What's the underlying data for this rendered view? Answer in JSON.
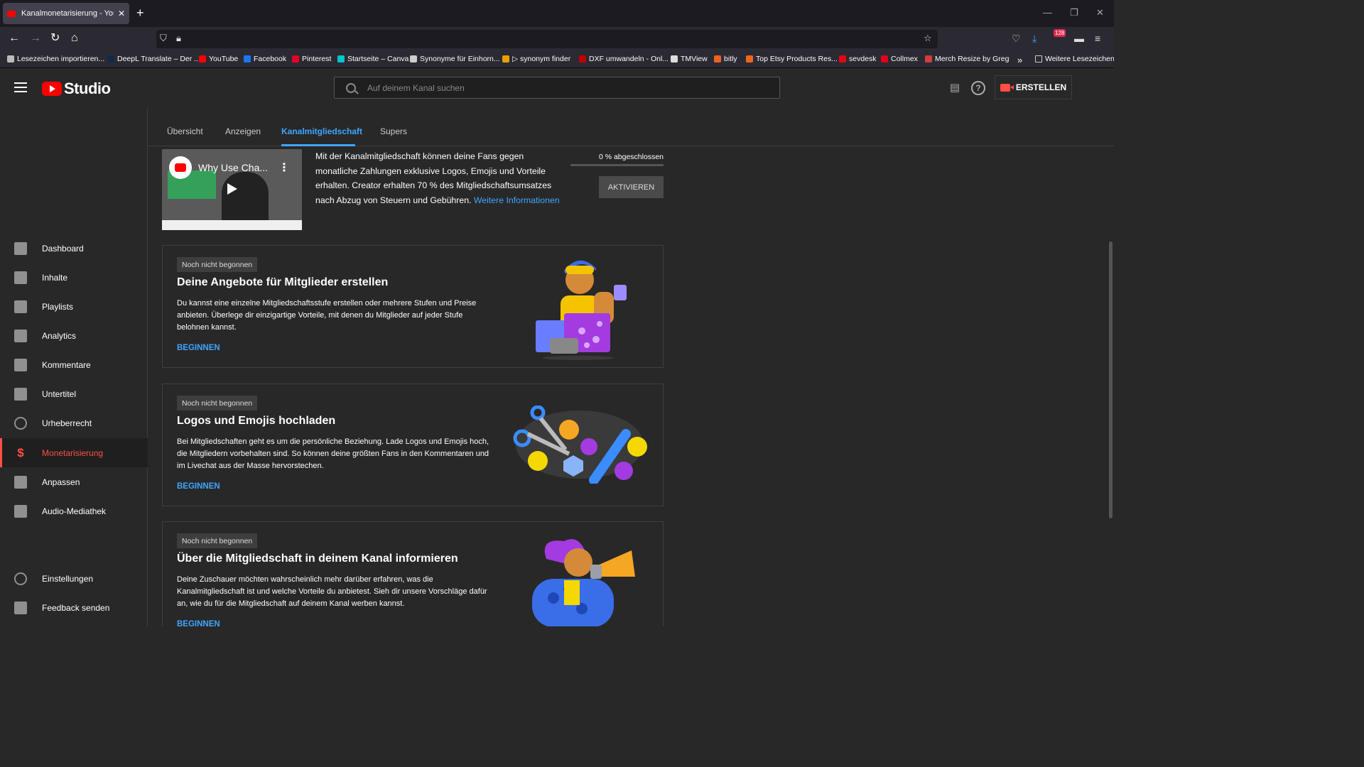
{
  "browser": {
    "tab_title": "Kanalmonetarisierung - YouTube",
    "tab_close": "✕",
    "new_tab": "+",
    "bookmarks": [
      {
        "label": "Lesezeichen importieren...",
        "color": "#bbbbbb"
      },
      {
        "label": "DeepL Translate – Der ...",
        "color": "#0f2b46"
      },
      {
        "label": "YouTube",
        "color": "#ff0000"
      },
      {
        "label": "Facebook",
        "color": "#1877f2"
      },
      {
        "label": "Pinterest",
        "color": "#e60023"
      },
      {
        "label": "Startseite – Canva",
        "color": "#00c4cc"
      },
      {
        "label": "Synonyme für Einhorn...",
        "color": "#cccccc"
      },
      {
        "label": "▷ synonym finder",
        "color": "#e8a000"
      },
      {
        "label": "DXF umwandeln - Onl...",
        "color": "#c00000"
      },
      {
        "label": "TMView",
        "color": "#dddddd"
      },
      {
        "label": "bitly",
        "color": "#ee6123"
      },
      {
        "label": "Top Etsy Products Res...",
        "color": "#f1641e"
      },
      {
        "label": "sevdesk",
        "color": "#e30613"
      },
      {
        "label": "Collmex",
        "color": "#e2001a"
      },
      {
        "label": "Merch Resize by Greg",
        "color": "#d23c3c"
      }
    ],
    "more_bookmarks": "Weitere Lesezeichen",
    "badge_count": "128"
  },
  "header": {
    "logo_text": "Studio",
    "search_placeholder": "Auf deinem Kanal suchen",
    "create_label": "ERSTELLEN"
  },
  "sidebar": {
    "items": [
      {
        "label": "Dashboard",
        "name": "dashboard"
      },
      {
        "label": "Inhalte",
        "name": "inhalte"
      },
      {
        "label": "Playlists",
        "name": "playlists"
      },
      {
        "label": "Analytics",
        "name": "analytics"
      },
      {
        "label": "Kommentare",
        "name": "kommentare"
      },
      {
        "label": "Untertitel",
        "name": "untertitel"
      },
      {
        "label": "Urheberrecht",
        "name": "urheberrecht"
      },
      {
        "label": "Monetarisierung",
        "name": "monetarisierung",
        "active": true
      },
      {
        "label": "Anpassen",
        "name": "anpassen"
      },
      {
        "label": "Audio-Mediathek",
        "name": "audio-mediathek"
      }
    ],
    "bottom_items": [
      {
        "label": "Einstellungen",
        "name": "einstellungen"
      },
      {
        "label": "Feedback senden",
        "name": "feedback-senden"
      }
    ],
    "active_icon": "$"
  },
  "tabs": [
    {
      "label": "Übersicht"
    },
    {
      "label": "Anzeigen"
    },
    {
      "label": "Kanalmitgliedschaft",
      "active": true
    },
    {
      "label": "Supers"
    }
  ],
  "intro": {
    "video_title": "Why Use Cha...",
    "text": "Mit der Kanalmitgliedschaft können deine Fans gegen monatliche Zahlungen exklusive Logos, Emojis und Vorteile erhalten. Creator erhalten 70 % des Mitgliedschaftsumsatzes nach Abzug von Steuern und Gebühren.",
    "link": "Weitere Informationen",
    "progress_label": "0 % abgeschlossen",
    "progress": 0,
    "activate_label": "AKTIVIEREN"
  },
  "cards": [
    {
      "badge": "Noch nicht begonnen",
      "title": "Deine Angebote für Mitglieder erstellen",
      "desc": "Du kannst eine einzelne Mitgliedschaftsstufe erstellen oder mehrere Stufen und Preise anbieten. Überlege dir einzigartige Vorteile, mit denen du Mitglieder auf jeder Stufe belohnen kannst.",
      "button": "BEGINNEN"
    },
    {
      "badge": "Noch nicht begonnen",
      "title": "Logos und Emojis hochladen",
      "desc": "Bei Mitgliedschaften geht es um die persönliche Beziehung. Lade Logos und Emojis hoch, die Mitgliedern vorbehalten sind. So können deine größten Fans in den Kommentaren und im Livechat aus der Masse hervorstechen.",
      "button": "BEGINNEN"
    },
    {
      "badge": "Noch nicht begonnen",
      "title": "Über die Mitgliedschaft in deinem Kanal informieren",
      "desc": "Deine Zuschauer möchten wahrscheinlich mehr darüber erfahren, was die Kanalmitgliedschaft ist und welche Vorteile du anbietest. Sieh dir unsere Vorschläge dafür an, wie du für die Mitgliedschaft auf deinem Kanal werben kannst.",
      "button": "BEGINNEN"
    }
  ],
  "colors": {
    "accent_blue": "#3ea6ff",
    "brand_red": "#ff0000",
    "active_red": "#ff4e45"
  }
}
